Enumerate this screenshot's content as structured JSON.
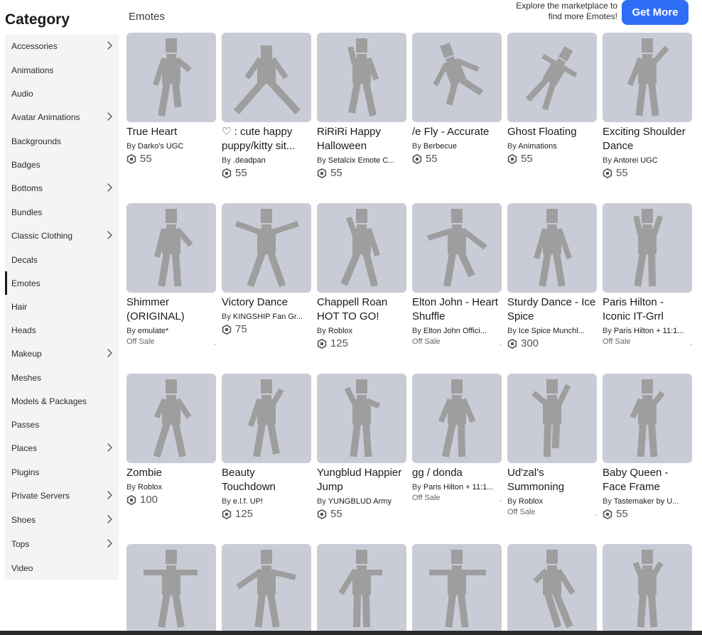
{
  "sidebar": {
    "title": "Category",
    "active": "Emotes",
    "items": [
      {
        "label": "Accessories",
        "chevron": true
      },
      {
        "label": "Animations",
        "chevron": false
      },
      {
        "label": "Audio",
        "chevron": false
      },
      {
        "label": "Avatar Animations",
        "chevron": true
      },
      {
        "label": "Backgrounds",
        "chevron": false
      },
      {
        "label": "Badges",
        "chevron": false
      },
      {
        "label": "Bottoms",
        "chevron": true
      },
      {
        "label": "Bundles",
        "chevron": false
      },
      {
        "label": "Classic Clothing",
        "chevron": true
      },
      {
        "label": "Decals",
        "chevron": false
      },
      {
        "label": "Emotes",
        "chevron": false
      },
      {
        "label": "Hair",
        "chevron": false
      },
      {
        "label": "Heads",
        "chevron": false
      },
      {
        "label": "Makeup",
        "chevron": true
      },
      {
        "label": "Meshes",
        "chevron": false
      },
      {
        "label": "Models & Packages",
        "chevron": false
      },
      {
        "label": "Passes",
        "chevron": false
      },
      {
        "label": "Places",
        "chevron": true
      },
      {
        "label": "Plugins",
        "chevron": false
      },
      {
        "label": "Private Servers",
        "chevron": true
      },
      {
        "label": "Shoes",
        "chevron": true
      },
      {
        "label": "Tops",
        "chevron": true
      },
      {
        "label": "Video",
        "chevron": false
      }
    ]
  },
  "header": {
    "section_title": "Emotes",
    "explore_line1": "Explore the marketplace to",
    "explore_line2": "find more Emotes!",
    "get_more_label": "Get More"
  },
  "items": [
    {
      "name": "True Heart",
      "by": "By",
      "creator": "Darko's UGC",
      "price": "55",
      "offsale": ""
    },
    {
      "name": "♡ : cute happy puppy/kitty sit...",
      "by": "By",
      "creator": ".deadpan",
      "price": "55",
      "offsale": ""
    },
    {
      "name": "RiRiRi Happy Halloween",
      "by": "By",
      "creator": "Setalcix Emote C...",
      "price": "55",
      "offsale": ""
    },
    {
      "name": "/e Fly - Accurate",
      "by": "By",
      "creator": "Berbecue",
      "price": "55",
      "offsale": ""
    },
    {
      "name": "Ghost Floating",
      "by": "By",
      "creator": "Animations",
      "price": "55",
      "offsale": ""
    },
    {
      "name": "Exciting Shoulder Dance",
      "by": "By",
      "creator": "Antorei UGC",
      "price": "55",
      "offsale": ""
    },
    {
      "name": "Shimmer (ORIGINAL)",
      "by": "By",
      "creator": "emulate*",
      "price": "",
      "offsale": "Off Sale"
    },
    {
      "name": "Victory Dance",
      "by": "By",
      "creator": "KINGSHIP Fan Gr...",
      "price": "75",
      "offsale": ""
    },
    {
      "name": "Chappell Roan HOT TO GO!",
      "by": "By",
      "creator": "Roblox",
      "price": "125",
      "offsale": ""
    },
    {
      "name": "Elton John - Heart Shuffle",
      "by": "By",
      "creator": "Elton John Offici...",
      "price": "",
      "offsale": "Off Sale"
    },
    {
      "name": "Sturdy Dance - Ice Spice",
      "by": "By",
      "creator": "Ice Spice Munchl...",
      "price": "300",
      "offsale": ""
    },
    {
      "name": "Paris Hilton - Iconic IT-Grrl",
      "by": "By",
      "creator": "Paris Hilton + 11:1...",
      "price": "",
      "offsale": "Off Sale"
    },
    {
      "name": "Zombie",
      "by": "By",
      "creator": "Roblox",
      "price": "100",
      "offsale": ""
    },
    {
      "name": "Beauty Touchdown",
      "by": "By",
      "creator": "e.l.f. UP!",
      "price": "125",
      "offsale": ""
    },
    {
      "name": "Yungblud Happier Jump",
      "by": "By",
      "creator": "YUNGBLUD Army",
      "price": "55",
      "offsale": ""
    },
    {
      "name": "gg / donda",
      "by": "By",
      "creator": "Paris Hilton + 11:1...",
      "price": "",
      "offsale": "Off Sale"
    },
    {
      "name": "Ud'zal's Summoning",
      "by": "By",
      "creator": "Roblox",
      "price": "",
      "offsale": "Off Sale"
    },
    {
      "name": "Baby Queen - Face Frame",
      "by": "By",
      "creator": "Tastemaker by U...",
      "price": "55",
      "offsale": ""
    },
    {
      "name": "",
      "by": "",
      "creator": "",
      "price": "",
      "offsale": ""
    },
    {
      "name": "",
      "by": "",
      "creator": "",
      "price": "",
      "offsale": ""
    },
    {
      "name": "",
      "by": "",
      "creator": "",
      "price": "",
      "offsale": ""
    },
    {
      "name": "",
      "by": "",
      "creator": "",
      "price": "",
      "offsale": ""
    },
    {
      "name": "",
      "by": "",
      "creator": "",
      "price": "",
      "offsale": ""
    },
    {
      "name": "",
      "by": "",
      "creator": "",
      "price": "",
      "offsale": ""
    }
  ],
  "offsale_dot": ".",
  "icons": {
    "chevron": "chevron-right-icon",
    "currency": "robux-icon",
    "thumbnail": "avatar-figure-icon"
  },
  "colors": {
    "accent": "#2f6df6",
    "thumbnail_bg": "#c9ccd6",
    "figure": "#9e9e9e",
    "sidebar_bg": "#f4f4f5"
  }
}
